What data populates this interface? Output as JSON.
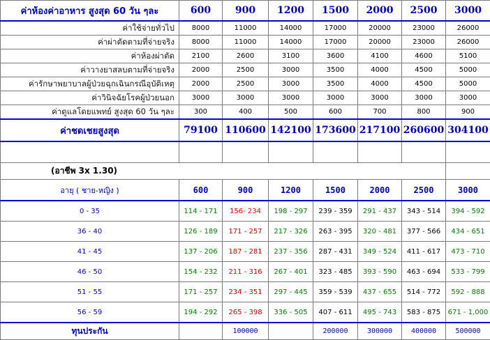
{
  "plans": [
    "600",
    "900",
    "1200",
    "1500",
    "2000",
    "2500",
    "3000"
  ],
  "header_title": "ค่าห้องค่าอาหาร สูงสุด 60 วัน ๆละ",
  "rows": [
    {
      "label": "ค่าใช้จ่ายทั่วไป",
      "values": [
        "8000",
        "11000",
        "14000",
        "17000",
        "20000",
        "23000",
        "26000"
      ]
    },
    {
      "label": "ค่าผ่าตัดตามที่จ่ายจริง",
      "values": [
        "8000",
        "11000",
        "14000",
        "17000",
        "20000",
        "23000",
        "26000"
      ]
    },
    {
      "label": "ค่าห้องผ่าตัด",
      "values": [
        "2100",
        "2600",
        "3100",
        "3600",
        "4100",
        "4600",
        "5100"
      ]
    },
    {
      "label": "ค่าวางยาสลบตามที่จ่ายจริง",
      "values": [
        "2000",
        "2500",
        "3000",
        "3500",
        "4000",
        "4500",
        "5000"
      ]
    },
    {
      "label": "ค่ารักษาพยาบาลผู้ป่วยฉุกเฉินกรณีอุบัติเหตุ",
      "values": [
        "2000",
        "2500",
        "3000",
        "3500",
        "4000",
        "4500",
        "5000"
      ]
    },
    {
      "label": "ค่าวินิจฉัยโรคผู้ป่วยนอก",
      "values": [
        "3000",
        "3000",
        "3000",
        "3000",
        "3000",
        "3000",
        "3000"
      ]
    },
    {
      "label": "ค่าดูแลโดยแพทย์ สูงสุด 60 วัน ๆละ",
      "values": [
        "300",
        "400",
        "500",
        "600",
        "700",
        "800",
        "900"
      ]
    }
  ],
  "total": {
    "label": "ค่าชดเชยสูงสุด",
    "values": [
      "79100",
      "110600",
      "142100",
      "173600",
      "217100",
      "260600",
      "304100"
    ]
  },
  "occupation_note": "(อาชีพ 3x 1.30)",
  "age_header": "อายุ ( ชาย-หญิง )",
  "age_plans": [
    "600",
    "900",
    "1200",
    "1500",
    "2000",
    "2500",
    "3000"
  ],
  "column_colors": [
    "green",
    "red",
    "green",
    "black",
    "green",
    "black",
    "green"
  ],
  "age_rows": [
    {
      "age": "0 - 35",
      "values": [
        "114 - 171",
        "156- 234",
        "198 - 297",
        "239 - 359",
        "291 - 437",
        "343 - 514",
        "394 - 592"
      ]
    },
    {
      "age": "36 - 40",
      "values": [
        "126 - 189",
        "171 - 257",
        "217 - 326",
        "263 - 395",
        "320 - 481",
        "377 - 566",
        "434 - 651"
      ]
    },
    {
      "age": "41 - 45",
      "values": [
        "137 - 206",
        "187 - 281",
        "237 - 356",
        "287 - 431",
        "349 - 524",
        "411 - 617",
        "473 - 710"
      ]
    },
    {
      "age": "46 - 50",
      "values": [
        "154 - 232",
        "211 - 316",
        "267 - 401",
        "323 - 485",
        "393 - 590",
        "463 - 694",
        "533 - 799"
      ]
    },
    {
      "age": "51 - 55",
      "values": [
        "171 - 257",
        "234 - 351",
        "297 - 445",
        "359 - 539",
        "437 - 655",
        "514 - 772",
        "592 - 888"
      ]
    },
    {
      "age": "56 - 59",
      "values": [
        "194 - 292",
        "265 - 398",
        "336 - 505",
        "407 - 611",
        "495 - 743",
        "583 - 875",
        "671 - 1,000"
      ]
    }
  ],
  "sum_insured": {
    "label": "ทุนประกัน",
    "values": [
      "",
      "100000",
      "",
      "200000",
      "300000",
      "400000",
      "500000"
    ]
  },
  "colors": {
    "accent": "#0000cc",
    "green": "#008000",
    "red": "#e00000",
    "border": "#7a7a7a"
  }
}
